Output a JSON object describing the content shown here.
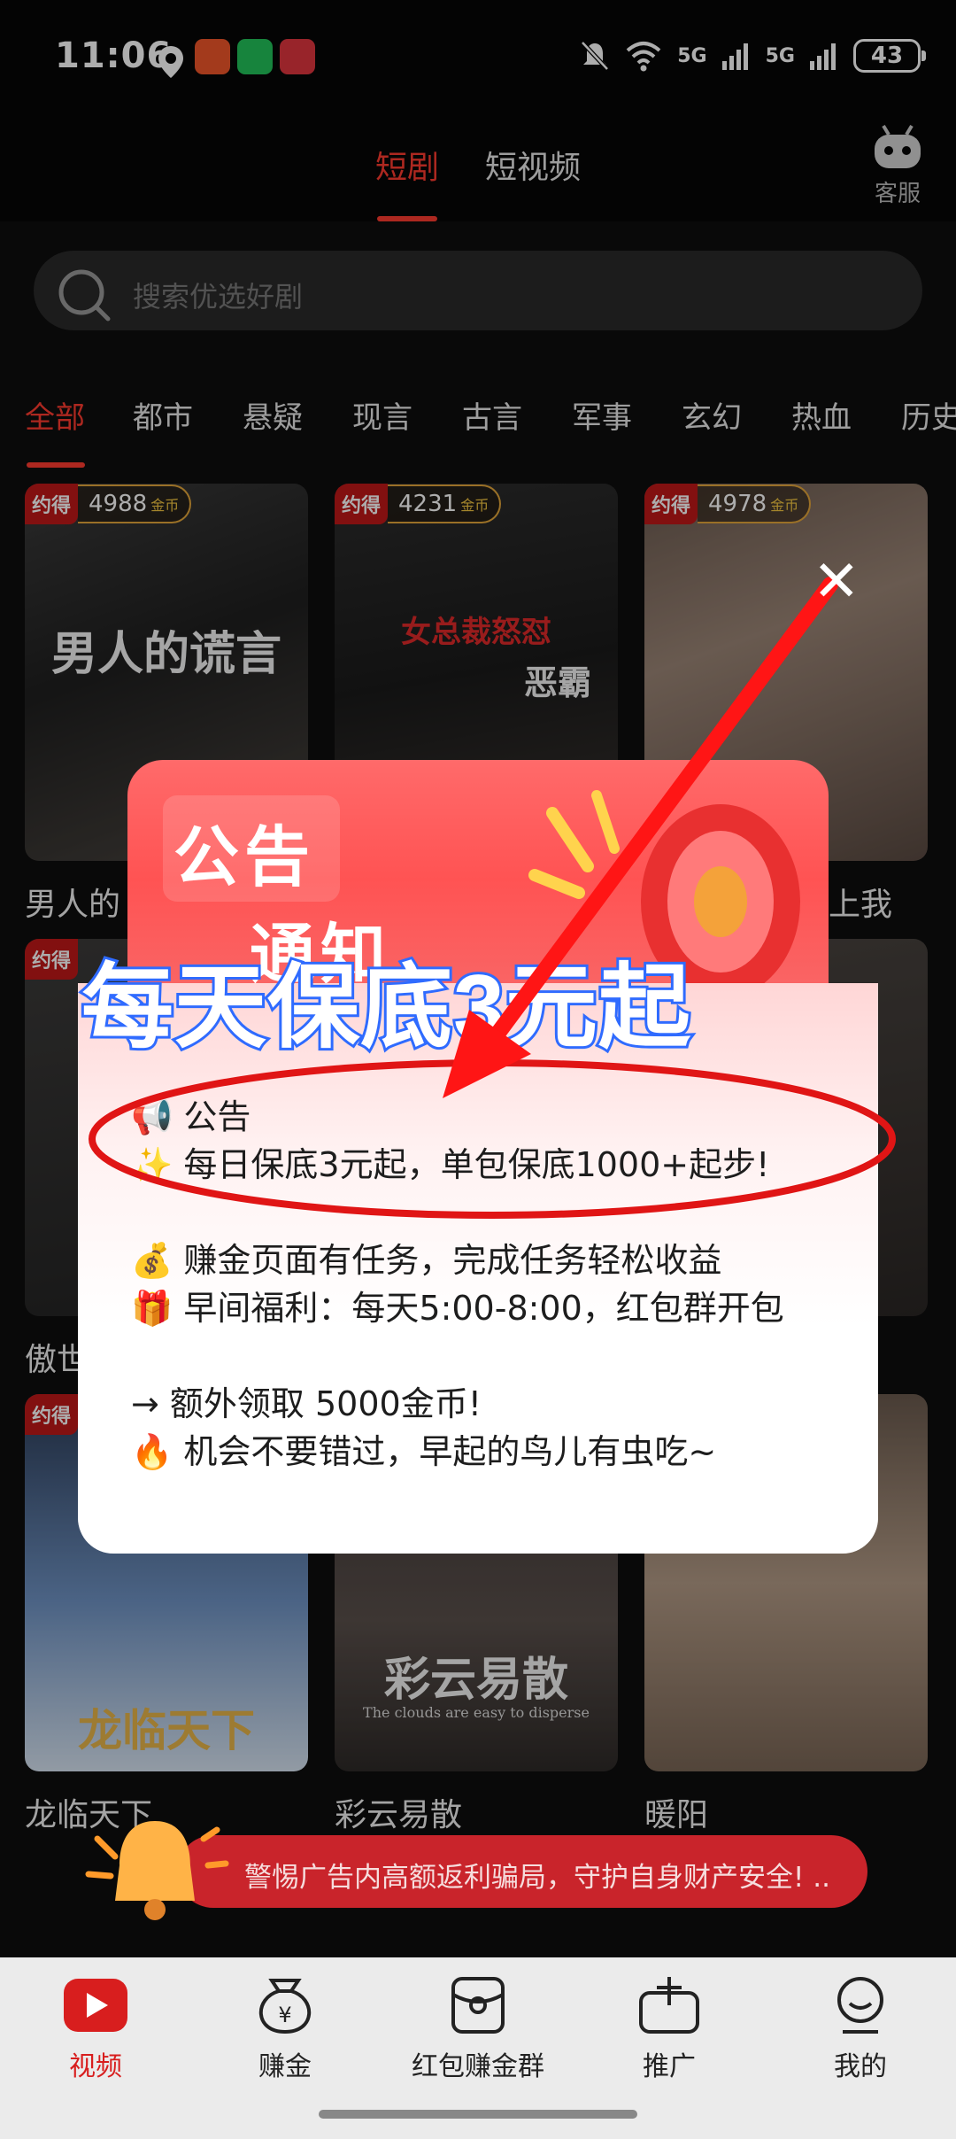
{
  "status_bar": {
    "time": "11:06",
    "network_1": "5G",
    "network_2": "5G",
    "wifi_tag": "6",
    "battery": "43"
  },
  "top_tabs": [
    {
      "label": "短剧",
      "active": true
    },
    {
      "label": "短视频",
      "active": false
    }
  ],
  "customer_service": {
    "label": "客服",
    "icon": "robot-icon"
  },
  "search": {
    "placeholder": "搜索优选好剧"
  },
  "categories": [
    "全部",
    "都市",
    "悬疑",
    "现言",
    "古言",
    "军事",
    "玄幻",
    "热血",
    "历史"
  ],
  "cards": [
    {
      "tag": "约得",
      "coins": "4988",
      "coin_unit": "金币",
      "title": "男人的",
      "art": "男人的谎言"
    },
    {
      "tag": "约得",
      "coins": "4231",
      "coin_unit": "金币",
      "title": "",
      "art_top": "女总裁怒怼",
      "art_sub": "恶霸"
    },
    {
      "tag": "约得",
      "coins": "4978",
      "coin_unit": "金币",
      "title": "上我",
      "art": ""
    },
    {
      "tag": "约得",
      "title": "傲世"
    },
    {
      "tag": "约得",
      "title": ""
    },
    {
      "tag": "",
      "title": ""
    },
    {
      "tag": "约得",
      "title": "龙临天下",
      "art": "龙临天下"
    },
    {
      "tag": "",
      "title": "彩云易散",
      "art": "彩云易散",
      "art_en": "The clouds are easy to disperse"
    },
    {
      "tag": "",
      "title": "暖阳"
    }
  ],
  "popup": {
    "header_line1": "公告",
    "header_line2": "通知",
    "banner": "每天保底3元起",
    "lines": [
      "📢 公告",
      "✨ 每日保底3元起，单包保底1000+起步!",
      "💰 赚金页面有任务，完成任务轻松收益",
      "🎁 早间福利：每天5:00-8:00，红包群开包",
      "→ 额外领取 5000金币!",
      "🔥 机会不要错过，早起的鸟儿有虫吃~"
    ],
    "close_icon": "close-icon"
  },
  "warning": {
    "text": "警惕广告内高额返利骗局，守护自身财产安全! .."
  },
  "bottom_nav": [
    {
      "label": "视频",
      "icon": "play-icon",
      "active": true
    },
    {
      "label": "赚金",
      "icon": "money-bag-icon",
      "active": false
    },
    {
      "label": "红包赚金群",
      "icon": "red-packet-icon",
      "active": false
    },
    {
      "label": "推广",
      "icon": "share-box-icon",
      "active": false
    },
    {
      "label": "我的",
      "icon": "profile-icon",
      "active": false
    }
  ],
  "colors": {
    "accent": "#ff3b30",
    "nav_bg": "#ebebeb",
    "banner_stroke": "#2f6bff",
    "warning_bg": "#c9242b"
  }
}
